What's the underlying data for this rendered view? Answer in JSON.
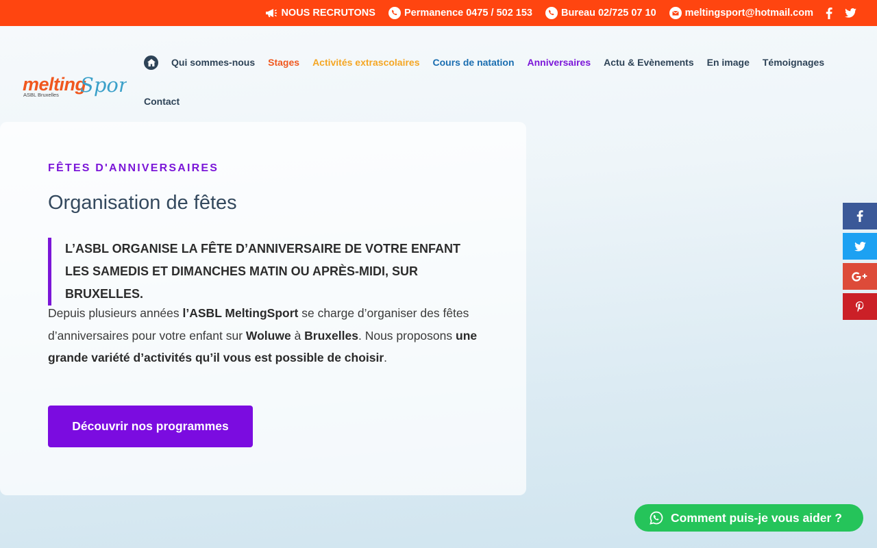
{
  "topbar": {
    "recruiting": "NOUS RECRUTONS",
    "permanence": "Permanence 0475 / 502 153",
    "bureau": "Bureau 02/725 07 10",
    "email": "meltingsport@hotmail.com",
    "background_color": "#ff4510"
  },
  "logo": {
    "name": "melting",
    "name2": "Sport",
    "tagline": "ASBL Bruxelles"
  },
  "nav": {
    "items": [
      "Qui sommes-nous",
      "Stages",
      "Activités extrascolaires",
      "Cours de natation",
      "Anniversaires",
      "Actu & Evènements",
      "En image",
      "Témoignages"
    ],
    "contact": "Contact"
  },
  "content": {
    "eyebrow": "FÊTES D'ANNIVERSAIRES",
    "title": "Organisation de fêtes",
    "quote": "L’ASBL ORGANISE LA FÊTE D’ANNIVERSAIRE DE VOTRE ENFANT LES SAMEDIS ET DIMANCHES MATIN OU APRÈS-MIDI, SUR BRUXELLES.",
    "p_1": "Depuis plusieurs années ",
    "p_2": "l’ASBL MeltingSport",
    "p_3": " se charge d’organiser des fêtes d’anniversaires pour votre enfant sur ",
    "p_4": "Woluwe",
    "p_5": " à ",
    "p_6": "Bruxelles",
    "p_7": ". Nous proposons ",
    "p_8": "une grande variété d’activités qu’il vous est possible de choisir",
    "p_9": ".",
    "cta": "Découvrir nos programmes",
    "accent_color": "#7b16d8"
  },
  "share": {
    "items": [
      {
        "icon": "facebook-icon",
        "color": "#3b5998"
      },
      {
        "icon": "twitter-icon",
        "color": "#1da1f2"
      },
      {
        "icon": "google-plus-icon",
        "color": "#dd4b39"
      },
      {
        "icon": "pinterest-icon",
        "color": "#cb2027"
      }
    ]
  },
  "whatsapp": {
    "label": "Comment puis-je vous aider ?",
    "color": "#25c45a"
  }
}
